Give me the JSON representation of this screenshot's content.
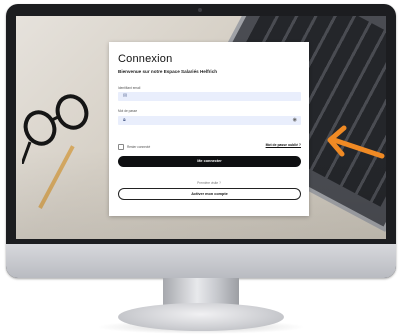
{
  "login": {
    "title": "Connexion",
    "subtitle": "Bienvenue sur notre Espace Salariés Helfrich",
    "email_label": "Identifiant email",
    "password_label": "Mot de passe",
    "remember_label": "Rester connecté",
    "forgot_link": "Mot de passe oublié ?",
    "submit_button": "Me connecter",
    "first_visit_text": "Première visite ?",
    "activate_button": "Activer mon compte"
  },
  "icons": {
    "email_field": "mail-icon",
    "password_field": "lock-icon",
    "password_toggle": "eye-icon",
    "overlay_arrow": "arrow-icon"
  },
  "colors": {
    "primary_button": "#0e0f11",
    "field_background": "#e9eefc",
    "arrow": "#f08a24"
  }
}
